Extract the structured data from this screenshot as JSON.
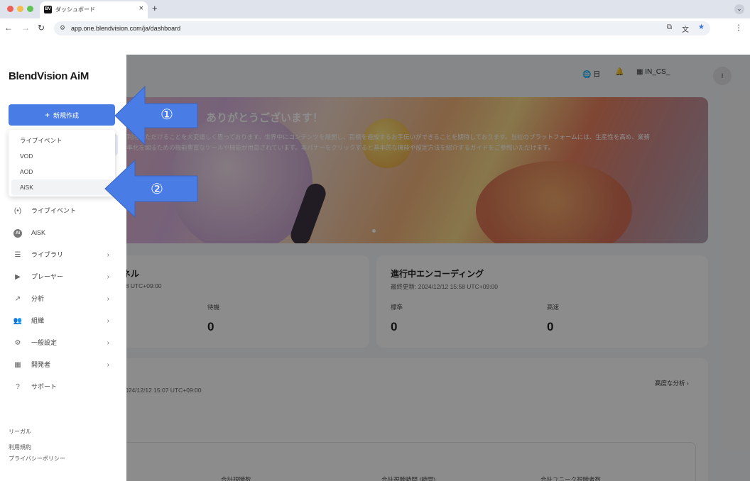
{
  "browser": {
    "tab_title": "ダッシュボード",
    "tab_favicon": "BV",
    "url": "app.one.blendvision.com/ja/dashboard"
  },
  "sidebar": {
    "logo": "BlendVision AiM",
    "new_button": "新規作成",
    "dropdown": [
      "ライブイベント",
      "VOD",
      "AOD",
      "AiSK"
    ],
    "nav": [
      {
        "label": "ライブイベント",
        "icon": "live-icon",
        "chevron": false
      },
      {
        "label": "AiSK",
        "icon": "ai-icon",
        "chevron": false
      },
      {
        "label": "ライブラリ",
        "icon": "library-icon",
        "chevron": true
      },
      {
        "label": "プレーヤー",
        "icon": "player-icon",
        "chevron": true
      },
      {
        "label": "分析",
        "icon": "analytics-icon",
        "chevron": true
      },
      {
        "label": "組織",
        "icon": "organization-icon",
        "chevron": true
      },
      {
        "label": "一般設定",
        "icon": "settings-icon",
        "chevron": true
      },
      {
        "label": "開発者",
        "icon": "developer-icon",
        "chevron": true
      },
      {
        "label": "サポート",
        "icon": "support-icon",
        "chevron": false
      }
    ],
    "legal_heading": "リーガル",
    "terms": "利用規約",
    "privacy": "プライバシーポリシー"
  },
  "header": {
    "language": "日",
    "org": "IN_CS_",
    "avatar": "I"
  },
  "banner": {
    "title": "ありがとうございます！",
    "line1": "ご利用いただけることを大変嬉しく思っております。世界中にコンテンツを展開し、目標を達成するお手伝いができることを期待しております。当社のプラットフォームには、生産性を高め、業務",
    "line2": "効率化を図るための機能豊富なツールや機能が用意されています。本バナーをクリックすると基本的な機能や設定方法を紹介するガイドをご参照いただけます。"
  },
  "cards": {
    "channel_title": "ネル",
    "channel_updated": "58 UTC+09:00",
    "channel_label": "待機",
    "channel_value": "0",
    "encoding_title": "進行中エンコーディング",
    "encoding_updated": "最終更新: 2024/12/12 15:58 UTC+09:00",
    "encoding_std_label": "標準",
    "encoding_std_value": "0",
    "encoding_fast_label": "高速",
    "encoding_fast_value": "0",
    "analytics_updated": "024/12/12 15:07 UTC+09:00",
    "analytics_link": "高度な分析",
    "stat1": "合計視聴数",
    "stat2": "合計視聴時間 (時間)",
    "stat3": "合計ユニーク視聴者数"
  },
  "annotations": [
    "①",
    "②"
  ],
  "colors": {
    "accent": "#4a7ce6",
    "arrow": "#4a7ce6"
  }
}
